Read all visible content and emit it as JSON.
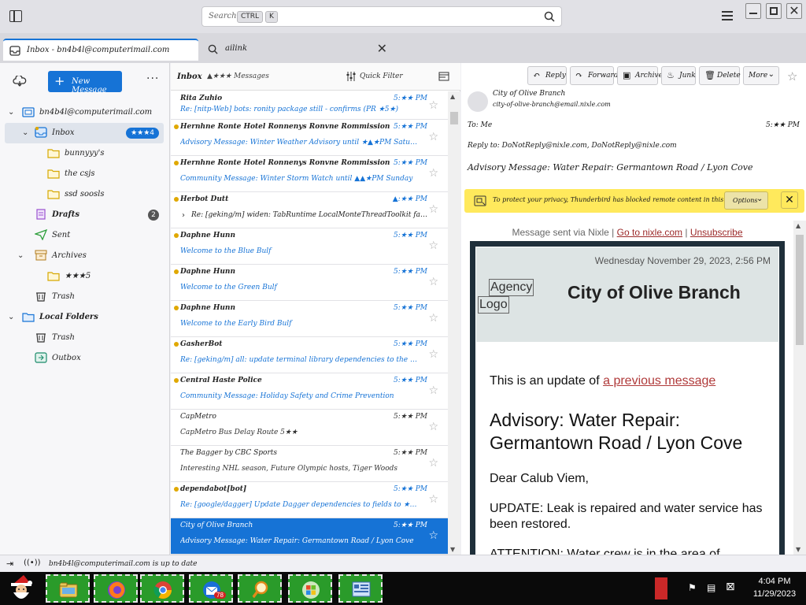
{
  "titlebar": {
    "search_placeholder": "Search...",
    "kbd_ctrl": "CTRL",
    "kbd_k": "K"
  },
  "tabs": [
    {
      "label": "Inbox - bn4b4l@computerimail.com"
    },
    {
      "label": "ailink"
    }
  ],
  "folder_pane": {
    "new_message": "New Message",
    "folders": [
      {
        "label": "bn4b4l@computerimail.com",
        "icon": "account-icon"
      },
      {
        "label": "Inbox",
        "icon": "inbox-icon",
        "badge": "★★★4"
      },
      {
        "label": "bunnyyy's",
        "icon": "folder-icon"
      },
      {
        "label": "the csjs",
        "icon": "folder-icon"
      },
      {
        "label": "ssd soosls",
        "icon": "folder-icon"
      },
      {
        "label": "Drafts",
        "icon": "drafts-icon",
        "badge": "2"
      },
      {
        "label": "Sent",
        "icon": "sent-icon"
      },
      {
        "label": "Archives",
        "icon": "archive-icon"
      },
      {
        "label": "★★★5",
        "icon": "folder-icon"
      },
      {
        "label": "Trash",
        "icon": "trash-icon"
      },
      {
        "label": "Local Folders",
        "icon": "local-folder-icon"
      },
      {
        "label": "Trash",
        "icon": "trash-icon"
      },
      {
        "label": "Outbox",
        "icon": "outbox-icon"
      }
    ]
  },
  "list": {
    "title": "Inbox",
    "count": "▲★★★ Messages",
    "quick_filter": "Quick Filter",
    "messages": [
      {
        "from": "Rita Zuhio",
        "time": "5:★★ PM",
        "subject": "Re: [nitp-Web] bots: ronity package still - confirms (PR ★5★)"
      },
      {
        "from": "Hernhne Ronte Hotel Ronnenys Ronvne Rommission",
        "time": "5:★★ PM",
        "subject": "Advisory Message: Winter Weather Advisory until ★▲★PM Saturday"
      },
      {
        "from": "Hernhne Ronte Hotel Ronnenys Ronvne Rommission",
        "time": "5:★★ PM",
        "subject": "Community Message: Winter Storm Watch until ▲▲★PM Sunday"
      },
      {
        "from": "Herbot Dutt",
        "time": "▲:★★ PM",
        "subject": "Re: [geking/m] widen: TabRuntime LocalMonteThreadToolkit failures —"
      },
      {
        "from": "Daphne Hunn",
        "time": "5:★★ PM",
        "subject": "Welcome to the Blue Bulf"
      },
      {
        "from": "Daphne Hunn",
        "time": "5:★★ PM",
        "subject": "Welcome to the Green Bulf"
      },
      {
        "from": "Daphne Hunn",
        "time": "5:★★ PM",
        "subject": "Welcome to the Early Bird Bulf"
      },
      {
        "from": "GasherBot",
        "time": "5:★★ PM",
        "subject": "Re: [geking/m] all: update terminal library dependencies to the last and set..."
      },
      {
        "from": "Central Haste Police",
        "time": "5:★★ PM",
        "subject": "Community Message: Holiday Safety and Crime Prevention"
      },
      {
        "from": "CapMetro",
        "time": "5:★★ PM",
        "subject": "CapMetro Bus Delay Route 5★★"
      },
      {
        "from": "The Bagger by CBC Sports",
        "time": "5:★★ PM",
        "subject": "Interesting NHL season, Future Olympic hosts, Tiger Woods"
      },
      {
        "from": "dependabot[bot]",
        "time": "5:★★ PM",
        "subject": "Re: [google/dagger] Update Dagger dependencies to fields to ★▲★★..."
      },
      {
        "from": "City of Olive Branch",
        "time": "5:★★ PM",
        "subject": "Advisory Message: Water Repair: Germantown Road / Lyon Cove"
      }
    ]
  },
  "reader": {
    "actions": [
      "Reply",
      "Forward",
      "Archive",
      "Junk",
      "Delete",
      "More"
    ],
    "from_name": "City of Olive Branch",
    "from_email": "city-of-olive-branch@email.nixle.com",
    "to_label": "To: Me",
    "time": "5:★★ PM",
    "reply_to": "Reply to: DoNotReply@nixle.com, DoNotReply@nixle.com",
    "subject": "Advisory Message: Water Repair: Germantown Road / Lyon Cove",
    "privacy_text": "To protect your privacy, Thunderbird has blocked remote content in this message.",
    "options": "Options",
    "body": {
      "sent_via": "Message sent via Nixle |",
      "goto_link": "Go to nixle.com",
      "sep": "|",
      "unsubscribe": "Unsubscribe",
      "date": "Wednesday November 29, 2023, 2:56 PM",
      "logo_line1": "Agency",
      "logo_line2": "Logo",
      "city": "City of Olive Branch",
      "update_prefix": "This is an update of",
      "update_link": "a previous message",
      "headline": "Advisory: Water Repair: Germantown Road / Lyon Cove",
      "greeting": "Dear Calub Viem,",
      "update_text": "UPDATE: Leak is repaired and water service has been restored.",
      "attention": "ATTENTION: Water crew is in the area of"
    }
  },
  "statusbar": {
    "text": "bn4b4l@computerimail.com is up to date"
  },
  "taskbar": {
    "time": "4:04 PM",
    "date": "11/29/2023",
    "badge": "78"
  }
}
